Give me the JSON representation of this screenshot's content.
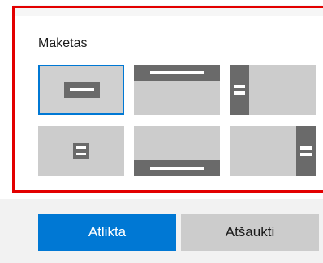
{
  "layout_section": {
    "label": "Maketas",
    "options": [
      {
        "id": "center",
        "icon": "layout-center-icon",
        "selected": true
      },
      {
        "id": "top",
        "icon": "layout-top-icon",
        "selected": false
      },
      {
        "id": "left",
        "icon": "layout-left-icon",
        "selected": false
      },
      {
        "id": "center-small",
        "icon": "layout-center-small-icon",
        "selected": false
      },
      {
        "id": "bottom",
        "icon": "layout-bottom-icon",
        "selected": false
      },
      {
        "id": "right",
        "icon": "layout-right-icon",
        "selected": false
      }
    ]
  },
  "actions": {
    "done_label": "Atlikta",
    "cancel_label": "Atšaukti"
  },
  "colors": {
    "accent": "#0078d4",
    "highlight_border": "#e30000",
    "tile_bg": "#cccccc",
    "glyph": "#6a6a6a"
  }
}
